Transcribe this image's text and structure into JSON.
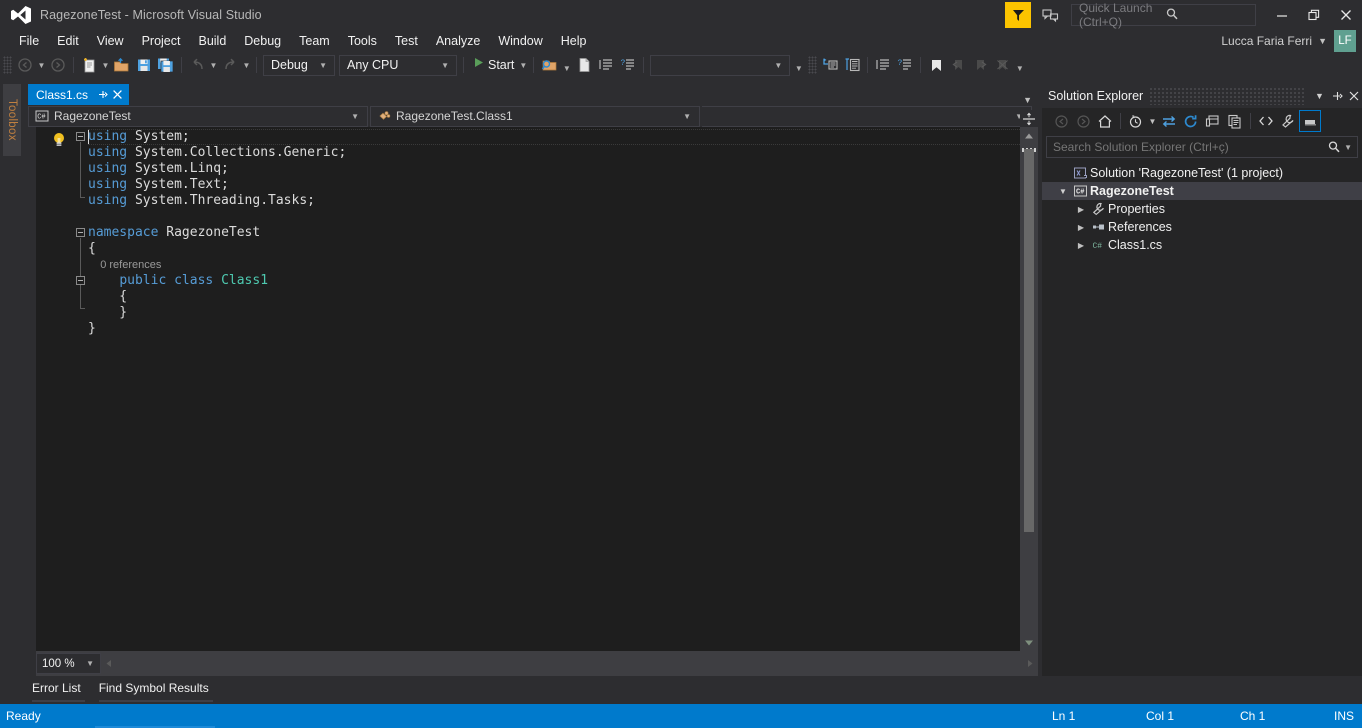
{
  "titlebar": {
    "title": "RagezoneTest - Microsoft Visual Studio",
    "logo_icon": "visual-studio-logo",
    "feedback_flag_icon": "feedback-flag-icon",
    "feedback_icon": "send-feedback-icon",
    "quick_launch_placeholder": "Quick Launch (Ctrl+Q)",
    "search_icon": "search-icon",
    "minimize_icon": "minimize-icon",
    "restore_icon": "restore-icon",
    "close_icon": "close-icon",
    "account_name": "Lucca Faria Ferri",
    "account_caret_icon": "chevron-down-icon",
    "avatar_initials": "LF",
    "avatar_color": "#60a090",
    "accent_color": "#007acc",
    "feedback_color": "#fcc400"
  },
  "menubar": {
    "items": [
      {
        "label": "File"
      },
      {
        "label": "Edit"
      },
      {
        "label": "View"
      },
      {
        "label": "Project"
      },
      {
        "label": "Build"
      },
      {
        "label": "Debug"
      },
      {
        "label": "Team"
      },
      {
        "label": "Tools"
      },
      {
        "label": "Test"
      },
      {
        "label": "Analyze"
      },
      {
        "label": "Window"
      },
      {
        "label": "Help"
      }
    ]
  },
  "toolbar": {
    "nav_back_icon": "navigate-back-icon",
    "nav_forward_icon": "navigate-forward-icon",
    "new_project_icon": "new-project-icon",
    "open_file_icon": "open-file-icon",
    "save_icon": "save-icon",
    "save_all_icon": "save-all-icon",
    "undo_icon": "undo-icon",
    "redo_icon": "redo-icon",
    "configuration": "Debug",
    "platform": "Any CPU",
    "start_label": "Start",
    "start_icon": "play-icon",
    "find_icon": "find-in-files-icon",
    "new_file_icon": "new-file-icon",
    "comment_icon": "comment-selection-icon",
    "uncomment_icon": "uncomment-selection-icon",
    "find_combo_value": "",
    "step_into_icon": "step-into-icon",
    "step_over_icon": "step-over-icon",
    "indent_icon": "increase-indent-icon",
    "outdent_icon": "decrease-indent-icon",
    "bookmark_icon": "bookmark-icon",
    "prev_bookmark_icon": "previous-bookmark-icon",
    "next_bookmark_icon": "next-bookmark-icon",
    "clear_bookmarks_icon": "clear-bookmarks-icon",
    "overflow_icon": "toolbar-overflow-icon"
  },
  "toolbox": {
    "label": "Toolbox"
  },
  "editor": {
    "tab": {
      "name": "Class1.cs",
      "pin_icon": "pin-icon",
      "close_icon": "close-icon"
    },
    "nav": {
      "project_icon": "csharp-file-icon",
      "project": "RagezoneTest",
      "member_icon": "class-icon",
      "member": "RagezoneTest.Class1",
      "dropdown_icon": "chevron-down-icon"
    },
    "lightbulb_icon": "quick-actions-lightbulb-icon",
    "split_icon": "split-editor-icon",
    "scroll_up_icon": "scroll-up-icon",
    "scroll_down_icon": "scroll-down-icon",
    "zoom_level": "100 %",
    "code_lines": [
      {
        "tokens": [
          {
            "t": "using",
            "c": "kw"
          },
          {
            "t": " System;",
            "c": "pln"
          }
        ]
      },
      {
        "tokens": [
          {
            "t": "using",
            "c": "kw"
          },
          {
            "t": " System.Collections.Generic;",
            "c": "pln"
          }
        ]
      },
      {
        "tokens": [
          {
            "t": "using",
            "c": "kw"
          },
          {
            "t": " System.Linq;",
            "c": "pln"
          }
        ]
      },
      {
        "tokens": [
          {
            "t": "using",
            "c": "kw"
          },
          {
            "t": " System.Text;",
            "c": "pln"
          }
        ]
      },
      {
        "tokens": [
          {
            "t": "using",
            "c": "kw"
          },
          {
            "t": " System.Threading.Tasks;",
            "c": "pln"
          }
        ]
      },
      {
        "tokens": []
      },
      {
        "tokens": [
          {
            "t": "namespace",
            "c": "kw"
          },
          {
            "t": " RagezoneTest",
            "c": "pln"
          }
        ]
      },
      {
        "tokens": [
          {
            "t": "{",
            "c": "punc"
          }
        ]
      },
      {
        "tokens": [
          {
            "t": "    0 references",
            "c": "lens"
          }
        ]
      },
      {
        "tokens": [
          {
            "t": "    ",
            "c": "pln"
          },
          {
            "t": "public",
            "c": "kw"
          },
          {
            "t": " ",
            "c": "pln"
          },
          {
            "t": "class",
            "c": "kw"
          },
          {
            "t": " ",
            "c": "pln"
          },
          {
            "t": "Class1",
            "c": "type"
          }
        ]
      },
      {
        "tokens": [
          {
            "t": "    {",
            "c": "punc"
          }
        ]
      },
      {
        "tokens": [
          {
            "t": "    }",
            "c": "punc"
          }
        ]
      },
      {
        "tokens": [
          {
            "t": "}",
            "c": "punc"
          }
        ]
      }
    ]
  },
  "bottom_tabs": {
    "items": [
      {
        "label": "Error List"
      },
      {
        "label": "Find Symbol Results"
      }
    ]
  },
  "solution_explorer": {
    "title": "Solution Explorer",
    "header_buttons": [
      {
        "name": "window-dropdown-icon",
        "glyph": "▾"
      },
      {
        "name": "pin-icon",
        "glyph": "pin"
      },
      {
        "name": "close-icon",
        "glyph": "✕"
      }
    ],
    "toolbar": {
      "back_icon": "navigate-back-icon",
      "forward_icon": "navigate-forward-icon",
      "home_icon": "home-icon",
      "pending_changes_icon": "pending-changes-icon",
      "pending_caret_icon": "chevron-down-icon",
      "sync_icon": "sync-with-active-document-icon",
      "refresh_icon": "refresh-icon",
      "collapse_all_icon": "collapse-all-icon",
      "show_all_files_icon": "show-all-files-icon",
      "view_code_icon": "view-code-icon",
      "properties_icon": "properties-wrench-icon",
      "preview_icon": "preview-selected-items-icon"
    },
    "search_placeholder": "Search Solution Explorer (Ctrl+ç)",
    "search_value": "",
    "search_icon": "search-icon",
    "search_caret_icon": "chevron-down-icon",
    "tree": [
      {
        "label": "Solution 'RagezoneTest' (1 project)",
        "icon": "solution-icon",
        "indent": 0,
        "expander": "",
        "bold": false,
        "selected": false
      },
      {
        "label": "RagezoneTest",
        "icon": "csharp-project-icon",
        "indent": 1,
        "expander": "▴",
        "bold": true,
        "selected": true
      },
      {
        "label": "Properties",
        "icon": "properties-wrench-icon",
        "indent": 2,
        "expander": "▸",
        "bold": false,
        "selected": false
      },
      {
        "label": "References",
        "icon": "references-icon",
        "indent": 2,
        "expander": "▸",
        "bold": false,
        "selected": false
      },
      {
        "label": "Class1.cs",
        "icon": "csharp-file-icon",
        "indent": 2,
        "expander": "▸",
        "bold": false,
        "selected": false
      }
    ]
  },
  "statusbar": {
    "message": "Ready",
    "line": "Ln 1",
    "column": "Col 1",
    "character": "Ch 1",
    "insert_mode": "INS",
    "background": "#007acc"
  }
}
